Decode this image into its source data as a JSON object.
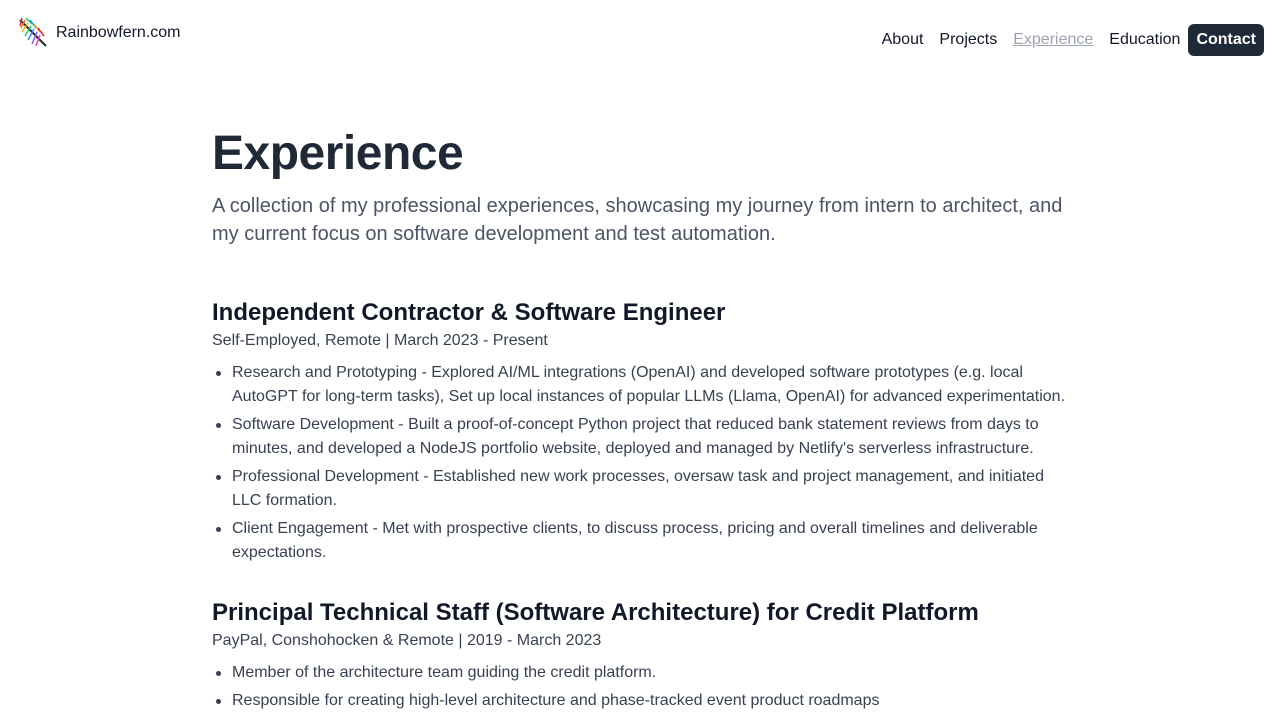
{
  "header": {
    "brand_name": "Rainbowfern.com",
    "nav": [
      {
        "label": "About"
      },
      {
        "label": "Projects"
      },
      {
        "label": "Experience"
      },
      {
        "label": "Education"
      },
      {
        "label": "Contact"
      }
    ]
  },
  "main": {
    "title": "Experience",
    "subtitle": "A collection of my professional experiences, showcasing my journey from intern to architect, and my current focus on software development and test automation.",
    "jobs": [
      {
        "title": "Independent Contractor & Software Engineer",
        "meta": "Self-Employed, Remote | March 2023 - Present",
        "items": [
          "Research and Prototyping - Explored AI/ML integrations (OpenAI) and developed software prototypes (e.g. local AutoGPT for long-term tasks), Set up local instances of popular LLMs (Llama, OpenAI) for advanced experimentation.",
          "Software Development - Built a proof-of-concept Python project that reduced bank statement reviews from days to minutes, and developed a NodeJS portfolio website, deployed and managed by Netlify's serverless infrastructure.",
          "Professional Development - Established new work processes, oversaw task and project management, and initiated LLC formation.",
          "Client Engagement - Met with prospective clients, to discuss process, pricing and overall timelines and deliverable expectations."
        ]
      },
      {
        "title": "Principal Technical Staff (Software Architecture) for Credit Platform",
        "meta": "PayPal, Conshohocken & Remote | 2019 - March 2023",
        "items": [
          "Member of the architecture team guiding the credit platform.",
          "Responsible for creating high-level architecture and phase-tracked event product roadmaps"
        ]
      }
    ]
  },
  "colors": {
    "text_primary": "#1f2937",
    "text_secondary": "#4b5563",
    "nav_active": "#9ca3af",
    "contact_bg": "#1f2937"
  }
}
